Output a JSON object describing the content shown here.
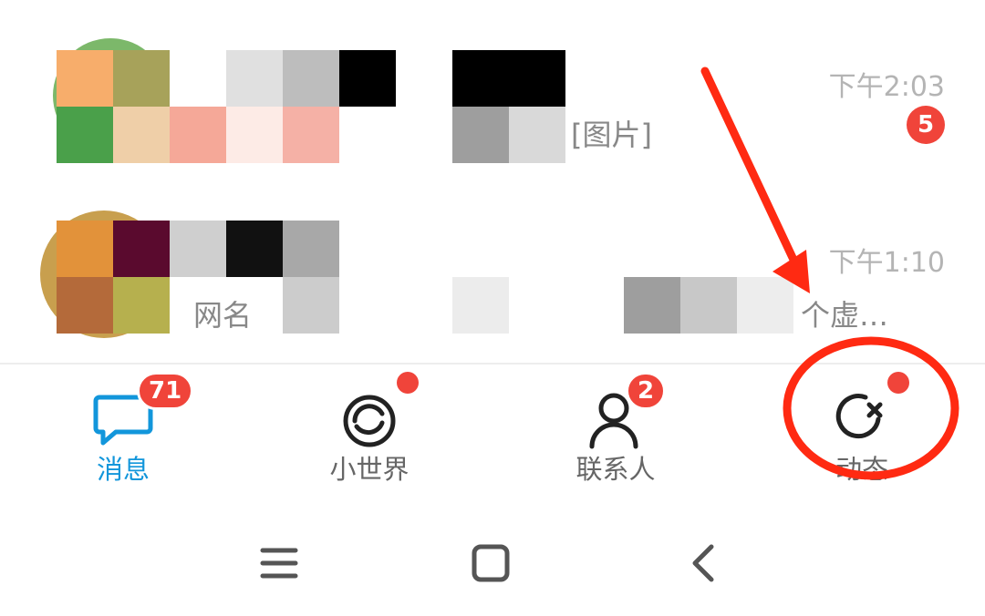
{
  "chats": [
    {
      "time": "下午2:03",
      "preview": "[图片]",
      "unread": "5"
    },
    {
      "time": "下午1:10",
      "preview_left": "网名",
      "preview_right": "个虚…"
    }
  ],
  "tabs": [
    {
      "label": "消息",
      "badge": "71",
      "icon": "message-icon",
      "active": true
    },
    {
      "label": "小世界",
      "icon": "small-world-icon"
    },
    {
      "label": "联系人",
      "badge": "2",
      "icon": "contacts-icon"
    },
    {
      "label": "动态",
      "icon": "moments-icon"
    }
  ],
  "colors": {
    "accent": "#1296db",
    "badge_red": "#f0443a",
    "annotation_red": "#ff2a12"
  },
  "system_nav": [
    "menu-icon",
    "home-icon",
    "back-icon"
  ]
}
